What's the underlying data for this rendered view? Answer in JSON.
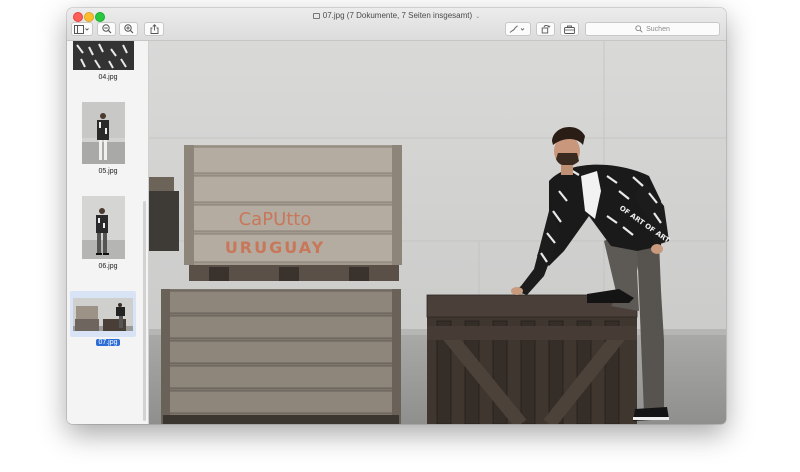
{
  "window": {
    "title": "07.jpg (7 Dokumente, 7 Seiten insgesamt)",
    "title_chevron": "⌄"
  },
  "toolbar": {
    "search_placeholder": "Suchen",
    "buttons": [
      "sidebar-toggle",
      "zoom-out",
      "zoom-in",
      "share",
      "markup-pen",
      "rotate",
      "toolbox"
    ]
  },
  "sidebar": {
    "items": [
      {
        "label": "04.jpg",
        "selected": false
      },
      {
        "label": "05.jpg",
        "selected": false
      },
      {
        "label": "06.jpg",
        "selected": false
      },
      {
        "label": "07.jpg",
        "selected": true
      }
    ]
  },
  "photo": {
    "crate_text_line1": "CaPUtto",
    "crate_text_line2": "URUGUAY",
    "jacket_print": "OF ART OF ART"
  },
  "colors": {
    "selection": "#2b6cd6",
    "close": "#ff5f57",
    "minimize": "#ffbd2e",
    "maximize": "#28c940"
  }
}
